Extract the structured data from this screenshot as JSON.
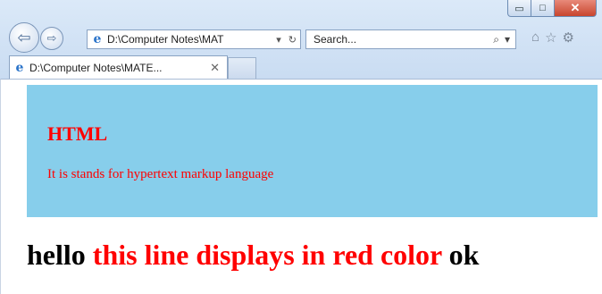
{
  "browser": {
    "address": "D:\\Computer Notes\\MAT",
    "address_dropdown": "▾",
    "refresh": "↻",
    "search_placeholder": "Search...",
    "search_icon": "⌕",
    "search_dropdown": "▾",
    "tab_title": "D:\\Computer Notes\\MATE...",
    "tab_close": "✕",
    "window_min": "▭",
    "window_max": "□",
    "window_close": "✕",
    "home": "⌂",
    "favorites": "☆",
    "settings": "⚙",
    "back": "⇦",
    "forward": "⇨"
  },
  "page": {
    "heading": "HTML",
    "paragraph": "It is stands for hypertext markup language",
    "line_start": "hello",
    "line_red": "this line displays in red color",
    "line_end": "ok",
    "panel_color": "#87ceeb",
    "red_color": "#ff0000"
  }
}
